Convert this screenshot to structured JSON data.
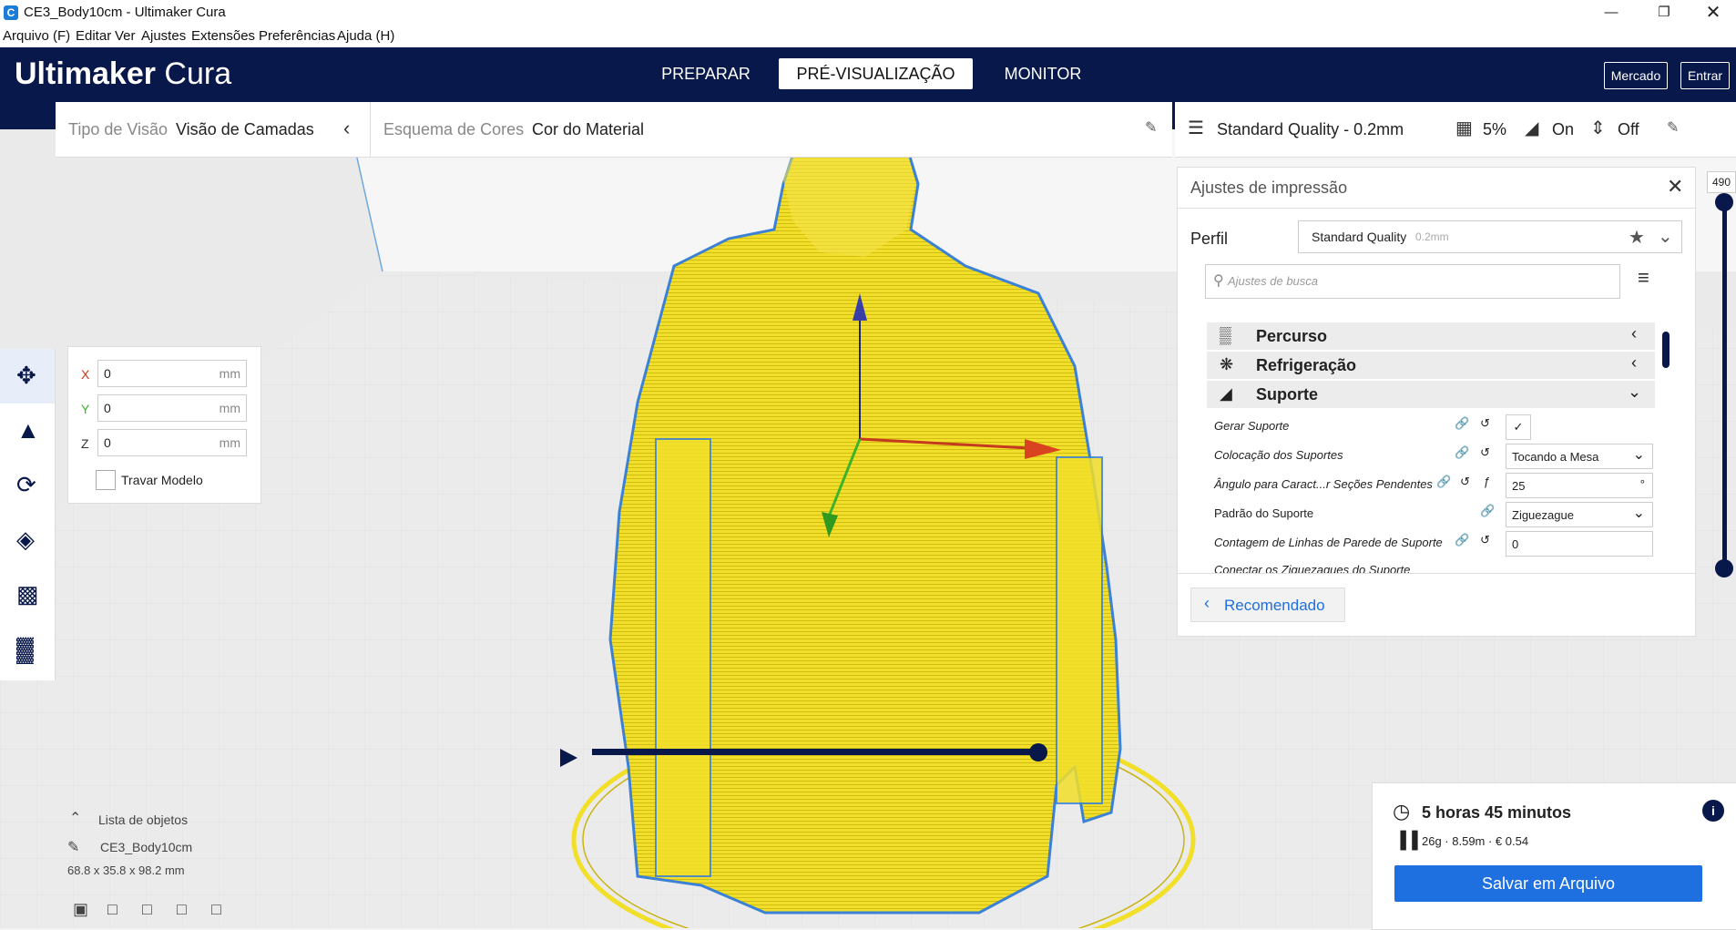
{
  "window": {
    "title": "CE3_Body10cm - Ultimaker Cura"
  },
  "menu": [
    {
      "label": "Arquivo (F)"
    },
    {
      "label": "Editar"
    },
    {
      "label": "Ver"
    },
    {
      "label": "Ajustes"
    },
    {
      "label": "Extensões"
    },
    {
      "label": "Preferências"
    },
    {
      "label": "Ajuda (H)"
    }
  ],
  "header": {
    "logo_bold": "Ultimaker",
    "logo_light": "Cura",
    "stages": [
      "PREPARAR",
      "PRÉ-VISUALIZAÇÃO",
      "MONITOR"
    ],
    "active_stage": "PRÉ-VISUALIZAÇÃO",
    "market": "Mercado",
    "login": "Entrar"
  },
  "viewbar": {
    "view_type_label": "Tipo de Visão",
    "view_type_value": "Visão de Camadas",
    "color_scheme_label": "Esquema de Cores",
    "color_scheme_value": "Cor do Material"
  },
  "printbar": {
    "quality": "Standard Quality - 0.2mm",
    "infill": "5%",
    "support": "On",
    "adhesion": "Off"
  },
  "move_panel": {
    "x_label": "X",
    "x_value": "0",
    "y_label": "Y",
    "y_value": "0",
    "z_label": "Z",
    "z_value": "0",
    "unit": "mm",
    "lock_label": "Travar Modelo"
  },
  "settings_panel": {
    "title": "Ajustes de impressão",
    "profile_label": "Perfil",
    "profile_value": "Standard Quality",
    "profile_sub": "0.2mm",
    "search_placeholder": "Ajustes de busca",
    "sections": [
      {
        "label": "Percurso"
      },
      {
        "label": "Refrigeração"
      },
      {
        "label": "Suporte"
      }
    ],
    "rows": [
      {
        "label": "Gerar Suporte",
        "value": ""
      },
      {
        "label": "Colocação dos Suportes",
        "value": "Tocando a Mesa"
      },
      {
        "label": "Ângulo para Caract...r Seções Pendentes",
        "value": "25",
        "unit": "°"
      },
      {
        "label": "Padrão do Suporte",
        "value": "Ziguezague"
      },
      {
        "label": "Contagem de Linhas de Parede de Suporte",
        "value": "0"
      },
      {
        "label": "Conectar os Ziguezagues do Suporte",
        "value": ""
      }
    ],
    "recommended": "Recomendado"
  },
  "layer_slider": {
    "value": "490"
  },
  "objects": {
    "header": "Lista de objetos",
    "name": "CE3_Body10cm",
    "dimensions": "68.8 x 35.8 x 98.2 mm"
  },
  "estimate": {
    "time": "5 horas 45 minutos",
    "material": "26g · 8.59m · € 0.54",
    "save": "Salvar em Arquivo"
  },
  "colors": {
    "header_bg": "#09184a",
    "model_yellow": "#f2df2a",
    "accent_blue": "#1e6fe0"
  }
}
